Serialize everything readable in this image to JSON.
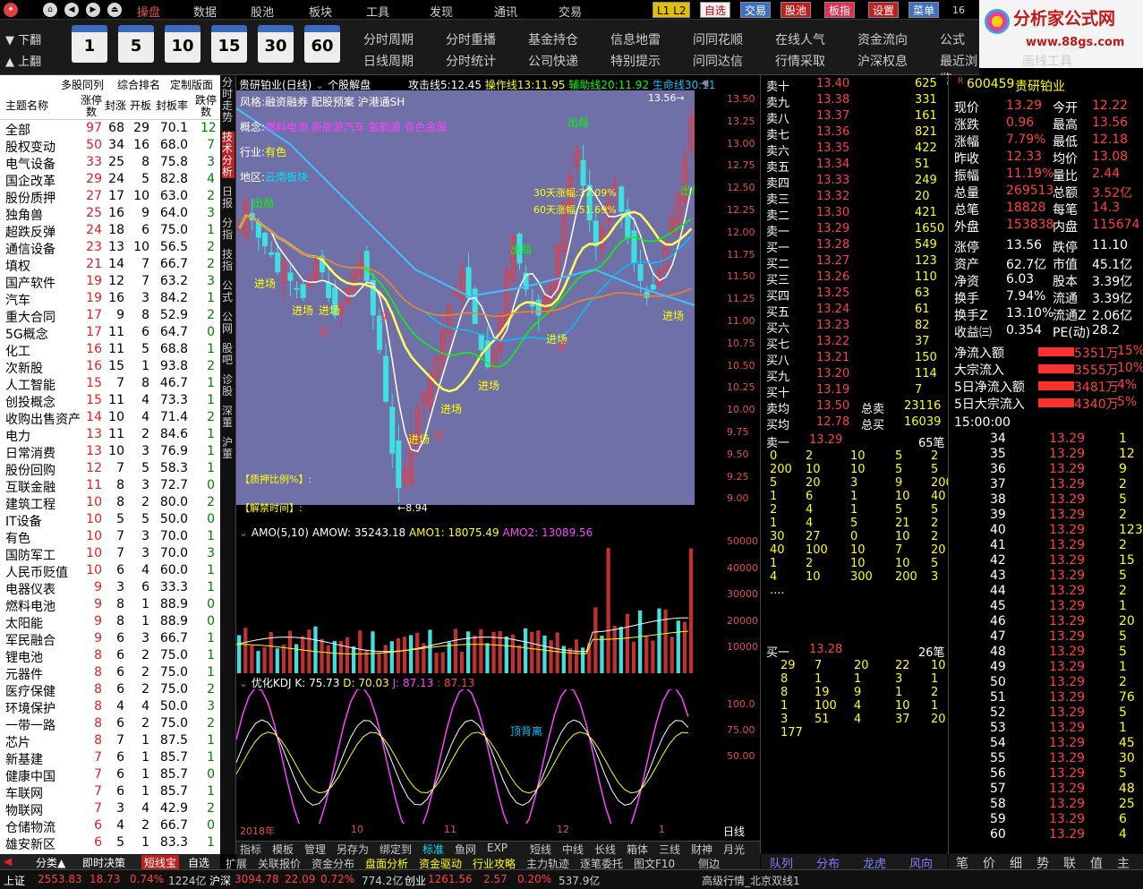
{
  "menubar": {
    "items": [
      "操盘",
      "数据",
      "股池",
      "板块",
      "工具",
      "发现",
      "通讯",
      "交易"
    ],
    "right_buttons": [
      "L1 L2",
      "自选",
      "交易",
      "股池",
      "板指",
      "设置",
      "菜单"
    ],
    "time": "16"
  },
  "logo": {
    "title": "分析家公式网",
    "url": "www.88gs.com"
  },
  "toolbar": {
    "page_up": "上翻",
    "page_down": "下翻",
    "periods": [
      "1",
      "5",
      "10",
      "15",
      "30",
      "60"
    ],
    "menu_row1": [
      "分时周期",
      "分时重播",
      "基金持仓",
      "信息地雷",
      "问同花顺",
      "在线人气",
      "资金流向",
      "公式"
    ],
    "menu_row2": [
      "日线周期",
      "分时统计",
      "公司快递",
      "特别提示",
      "问同达信",
      "行情采取",
      "沪深权息",
      "最近浏览",
      "画线工具"
    ]
  },
  "leftpanel": {
    "tabs": [
      "多股同列",
      "综合排名",
      "定制版面"
    ],
    "headers": [
      "主题名称",
      "涨停数",
      "封涨",
      "开板",
      "封板率",
      "跌停数"
    ],
    "rows": [
      [
        "全部",
        "97",
        "68",
        "29",
        "70.1",
        "12"
      ],
      [
        "股权变动",
        "50",
        "34",
        "16",
        "68.0",
        "7"
      ],
      [
        "电气设备",
        "33",
        "25",
        "8",
        "75.8",
        "3"
      ],
      [
        "国企改革",
        "29",
        "24",
        "5",
        "82.8",
        "4"
      ],
      [
        "股份质押",
        "27",
        "17",
        "10",
        "63.0",
        "2"
      ],
      [
        "独角兽",
        "25",
        "16",
        "9",
        "64.0",
        "3"
      ],
      [
        "超跌反弹",
        "24",
        "18",
        "6",
        "75.0",
        "1"
      ],
      [
        "通信设备",
        "23",
        "13",
        "10",
        "56.5",
        "2"
      ],
      [
        "填权",
        "21",
        "14",
        "7",
        "66.7",
        "2"
      ],
      [
        "国产软件",
        "19",
        "12",
        "7",
        "63.2",
        "3"
      ],
      [
        "汽车",
        "19",
        "16",
        "3",
        "84.2",
        "1"
      ],
      [
        "重大合同",
        "17",
        "9",
        "8",
        "52.9",
        "2"
      ],
      [
        "5G概念",
        "17",
        "11",
        "6",
        "64.7",
        "0"
      ],
      [
        "化工",
        "16",
        "11",
        "5",
        "68.8",
        "1"
      ],
      [
        "次新股",
        "16",
        "15",
        "1",
        "93.8",
        "2"
      ],
      [
        "人工智能",
        "15",
        "7",
        "8",
        "46.7",
        "1"
      ],
      [
        "创投概念",
        "15",
        "11",
        "4",
        "73.3",
        "1"
      ],
      [
        "收购出售资产",
        "14",
        "10",
        "4",
        "71.4",
        "2"
      ],
      [
        "电力",
        "13",
        "11",
        "2",
        "84.6",
        "1"
      ],
      [
        "日常消费",
        "13",
        "10",
        "3",
        "76.9",
        "1"
      ],
      [
        "股份回购",
        "12",
        "7",
        "5",
        "58.3",
        "1"
      ],
      [
        "互联金融",
        "11",
        "8",
        "3",
        "72.7",
        "0"
      ],
      [
        "建筑工程",
        "10",
        "8",
        "2",
        "80.0",
        "2"
      ],
      [
        "IT设备",
        "10",
        "5",
        "5",
        "50.0",
        "0"
      ],
      [
        "有色",
        "10",
        "7",
        "3",
        "70.0",
        "1"
      ],
      [
        "国防军工",
        "10",
        "7",
        "3",
        "70.0",
        "3"
      ],
      [
        "人民币贬值",
        "10",
        "6",
        "4",
        "60.0",
        "1"
      ],
      [
        "电器仪表",
        "9",
        "3",
        "6",
        "33.3",
        "1"
      ],
      [
        "燃料电池",
        "9",
        "8",
        "1",
        "88.9",
        "0"
      ],
      [
        "太阳能",
        "9",
        "8",
        "1",
        "88.9",
        "0"
      ],
      [
        "军民融合",
        "9",
        "6",
        "3",
        "66.7",
        "1"
      ],
      [
        "锂电池",
        "8",
        "6",
        "2",
        "75.0",
        "1"
      ],
      [
        "元器件",
        "8",
        "6",
        "2",
        "75.0",
        "1"
      ],
      [
        "医疗保健",
        "8",
        "6",
        "2",
        "75.0",
        "2"
      ],
      [
        "环境保护",
        "8",
        "4",
        "4",
        "50.0",
        "3"
      ],
      [
        "一带一路",
        "8",
        "6",
        "2",
        "75.0",
        "2"
      ],
      [
        "芯片",
        "8",
        "7",
        "1",
        "87.5",
        "1"
      ],
      [
        "新基建",
        "7",
        "6",
        "1",
        "85.7",
        "1"
      ],
      [
        "健康中国",
        "7",
        "6",
        "1",
        "85.7",
        "0"
      ],
      [
        "车联网",
        "7",
        "6",
        "1",
        "85.7",
        "1"
      ],
      [
        "物联网",
        "7",
        "3",
        "4",
        "42.9",
        "2"
      ],
      [
        "仓储物流",
        "6",
        "4",
        "2",
        "66.7",
        "0"
      ],
      [
        "雄安新区",
        "6",
        "5",
        "1",
        "83.3",
        "1"
      ]
    ],
    "footer": [
      "分类▲",
      "即时决策",
      "短线宝",
      "自选"
    ]
  },
  "vtabs": [
    "分时走势",
    "技术分析",
    "日报",
    "分指",
    "技指",
    "公式",
    "公网",
    "股吧",
    "诊股",
    "深董",
    "沪董"
  ],
  "kline": {
    "title": "贵研铂业(日线)",
    "indicator_label": "个股解盘",
    "lines": [
      {
        "name": "攻击线5:",
        "value": "12.45",
        "color": "#ffffff"
      },
      {
        "name": "操作线13:",
        "value": "11.95",
        "color": "#ffff00"
      },
      {
        "name": "辅助线20:",
        "value": "11.92",
        "color": "#00ff00"
      },
      {
        "name": "生命线30:",
        "value": "11",
        "color": "#00c0ff"
      }
    ],
    "style": "风格:",
    "style_val": "融资融券 配股预案 沪港通SH",
    "concept": "概念:",
    "concept_val": "燃料电池 新能源汽车 氢能源 有色金属",
    "industry": "行业:",
    "industry_val": "有色",
    "region": "地区:",
    "region_val": "云南板块",
    "stats": [
      "30天涨幅:37.09%",
      "60天涨幅:51.69%"
    ],
    "pledge": "【质押比例%】:",
    "ban": "【解禁时间】:",
    "low": "8.94",
    "high": "13.56",
    "labels": [
      "出局",
      "出局",
      "出局",
      "出局",
      "进场",
      "进场",
      "进场",
      "进场",
      "进场",
      "进场",
      "进场",
      "进场",
      "买",
      "买",
      "买",
      "买",
      "财",
      "涨"
    ],
    "price_axis": [
      "13.50",
      "13.25",
      "13.00",
      "12.75",
      "12.50",
      "12.25",
      "12.00",
      "11.75",
      "11.50",
      "11.25",
      "11.00",
      "10.75",
      "10.50",
      "10.25",
      "10.00",
      "9.75",
      "9.50",
      "9.25",
      "9.00"
    ]
  },
  "amo": {
    "title": "AMO(5,10)",
    "amow": "AMOW: 35243.18",
    "amo1": "AMO1: 18075.49",
    "amo2": "AMO2: 13089.56",
    "axis": [
      "50000",
      "40000",
      "30000",
      "20000",
      "10000"
    ]
  },
  "kdj": {
    "title": "优化KDJ",
    "k": "K: 75.73",
    "d": "D: 70.03",
    "j": "J: 87.13",
    "j2": ": 87.13",
    "label": "顶背离",
    "axis": [
      "100.0",
      "75.00",
      "50.00"
    ],
    "dates": [
      "2018年",
      "10",
      "11",
      "12",
      "1"
    ],
    "period": "日线"
  },
  "chart_data": [
    {
      "type": "bar",
      "title": "AMO(5,10)",
      "series": [
        {
          "name": "AMOW",
          "values": [
            35243.18
          ]
        },
        {
          "name": "AMO1",
          "values": [
            18075.49
          ]
        },
        {
          "name": "AMO2",
          "values": [
            13089.56
          ]
        }
      ],
      "ylim": [
        0,
        55000
      ]
    }
  ],
  "btmtabs": {
    "row1": [
      "指标",
      "模板",
      "管理",
      "另存为",
      "绑定到",
      "标准",
      "鱼网",
      "EXP",
      "短线",
      "中线",
      "长线",
      "箱体",
      "三线",
      "财神",
      "月光"
    ],
    "row2": [
      "扩展",
      "关联报价",
      "资金分布",
      "盘面分析",
      "资金驱动",
      "行业攻略",
      "主力轨迹",
      "逐笔委托",
      "图文F10",
      "侧边"
    ]
  },
  "orderbook": {
    "asks": [
      [
        "卖十",
        "13.40",
        "625"
      ],
      [
        "卖九",
        "13.38",
        "331"
      ],
      [
        "卖八",
        "13.37",
        "161"
      ],
      [
        "卖七",
        "13.36",
        "821"
      ],
      [
        "卖六",
        "13.35",
        "422"
      ],
      [
        "卖五",
        "13.34",
        "51"
      ],
      [
        "卖四",
        "13.33",
        "249"
      ],
      [
        "卖三",
        "13.32",
        "20"
      ],
      [
        "卖二",
        "13.30",
        "421"
      ],
      [
        "卖一",
        "13.29",
        "1650"
      ]
    ],
    "bids": [
      [
        "买一",
        "13.28",
        "549"
      ],
      [
        "买二",
        "13.27",
        "123"
      ],
      [
        "买三",
        "13.26",
        "110"
      ],
      [
        "买四",
        "13.25",
        "63"
      ],
      [
        "买五",
        "13.24",
        "61"
      ],
      [
        "买六",
        "13.23",
        "82"
      ],
      [
        "买七",
        "13.22",
        "37"
      ],
      [
        "买八",
        "13.21",
        "150"
      ],
      [
        "买九",
        "13.20",
        "114"
      ],
      [
        "买十",
        "13.19",
        "7"
      ]
    ],
    "avg_sell": [
      "卖均",
      "13.50",
      "总卖",
      "23116"
    ],
    "avg_buy": [
      "买均",
      "12.78",
      "总买",
      "16039"
    ],
    "sell1": [
      "卖一",
      "13.29",
      "65笔"
    ],
    "sell1_q": [
      [
        "0",
        "2",
        "10",
        "5",
        "2"
      ],
      [
        "200",
        "10",
        "10",
        "5",
        "5"
      ],
      [
        "5",
        "20",
        "3",
        "9",
        "200"
      ],
      [
        "1",
        "6",
        "1",
        "10",
        "40"
      ],
      [
        "2",
        "4",
        "1",
        "5",
        "5"
      ],
      [
        "1",
        "4",
        "5",
        "21",
        "2"
      ],
      [
        "30",
        "27",
        "0",
        "10",
        "2"
      ],
      [
        "40",
        "100",
        "10",
        "7",
        "20"
      ],
      [
        "1",
        "2",
        "10",
        "10",
        "5"
      ],
      [
        "4",
        "10",
        "300",
        "200",
        "3"
      ],
      [
        "....",
        "",
        "",
        "",
        ""
      ]
    ],
    "buy1": [
      "买一",
      "13.28",
      "26笔"
    ],
    "buy1_q": [
      [
        "29",
        "7",
        "20",
        "22",
        "10"
      ],
      [
        "8",
        "1",
        "1",
        "3",
        "1"
      ],
      [
        "8",
        "19",
        "9",
        "1",
        "2"
      ],
      [
        "1",
        "100",
        "4",
        "10",
        "1"
      ],
      [
        "3",
        "51",
        "4",
        "37",
        "20"
      ],
      [
        "177",
        "",
        "",
        "",
        ""
      ]
    ],
    "tabs": [
      "队列",
      "分布",
      "龙虎",
      "风向"
    ]
  },
  "quote": {
    "code": "600459",
    "name": "贵研铂业",
    "rows": [
      [
        "现价",
        "13.29",
        "今开",
        "12.22"
      ],
      [
        "涨跌",
        "0.96",
        "最高",
        "13.56"
      ],
      [
        "涨幅",
        "7.79%",
        "最低",
        "12.18"
      ],
      [
        "昨收",
        "12.33",
        "均价",
        "13.08"
      ],
      [
        "振幅",
        "11.19%",
        "量比",
        "2.44"
      ],
      [
        "总量",
        "269513",
        "总额",
        "3.52亿"
      ],
      [
        "总笔",
        "18828",
        "每笔",
        "14.3"
      ],
      [
        "外盘",
        "153838",
        "内盘",
        "115674"
      ]
    ],
    "rows2": [
      [
        "涨停",
        "13.56",
        "跌停",
        "11.10"
      ],
      [
        "资产",
        "62.7亿",
        "市值",
        "45.1亿"
      ],
      [
        "净资",
        "6.03",
        "股本",
        "3.39亿"
      ],
      [
        "换手",
        "7.94%",
        "流通",
        "3.39亿"
      ],
      [
        "换手Z",
        "13.10%",
        "流通Z",
        "2.06亿"
      ],
      [
        "收益㈢",
        "0.354",
        "PE(动)",
        "28.2"
      ]
    ],
    "flows": [
      [
        "净流入额",
        "5351万",
        "15%"
      ],
      [
        "大宗流入",
        "3555万",
        "10%"
      ],
      [
        "5日净流入额",
        "3481万",
        "4%"
      ],
      [
        "5日大宗流入",
        "4340万",
        "5%"
      ]
    ],
    "ticks_time": "15:00:00",
    "ticks": [
      [
        "34",
        "13.29",
        "1"
      ],
      [
        "35",
        "13.29",
        "12"
      ],
      [
        "36",
        "13.29",
        "9"
      ],
      [
        "37",
        "13.29",
        "2"
      ],
      [
        "38",
        "13.29",
        "5"
      ],
      [
        "39",
        "13.29",
        "2"
      ],
      [
        "40",
        "13.29",
        "123"
      ],
      [
        "41",
        "13.29",
        "2"
      ],
      [
        "42",
        "13.29",
        "15"
      ],
      [
        "43",
        "13.29",
        "5"
      ],
      [
        "44",
        "13.29",
        "2"
      ],
      [
        "45",
        "13.29",
        "1"
      ],
      [
        "46",
        "13.29",
        "20"
      ],
      [
        "47",
        "13.29",
        "5"
      ],
      [
        "48",
        "13.29",
        "5"
      ],
      [
        "49",
        "13.29",
        "1"
      ],
      [
        "50",
        "13.29",
        "2"
      ],
      [
        "51",
        "13.29",
        "76"
      ],
      [
        "52",
        "13.29",
        "5"
      ],
      [
        "53",
        "13.29",
        "1"
      ],
      [
        "54",
        "13.29",
        "45"
      ],
      [
        "55",
        "13.29",
        "30"
      ],
      [
        "56",
        "13.29",
        "5"
      ],
      [
        "57",
        "13.29",
        "48"
      ],
      [
        "58",
        "13.29",
        "25"
      ],
      [
        "59",
        "13.29",
        "6"
      ],
      [
        "60",
        "13.29",
        "4"
      ]
    ],
    "tabs": [
      "笔",
      "价",
      "细",
      "势",
      "联",
      "值",
      "主"
    ]
  },
  "status": {
    "sh_label": "上证",
    "sh": "2553.83",
    "sh_chg": "18.73",
    "sh_pct": "0.74%",
    "sh_amt": "1224亿",
    "sz_label": "沪深",
    "sz": "3094.78",
    "sz_chg": "22.09",
    "sz_pct": "0.72%",
    "sz_amt": "774.2亿",
    "cy_label": "创业",
    "cy": "1261.56",
    "cy_chg": "2.57",
    "cy_pct": "0.20%",
    "cy_amt": "537.9亿",
    "server": "高级行情_北京双线1"
  }
}
